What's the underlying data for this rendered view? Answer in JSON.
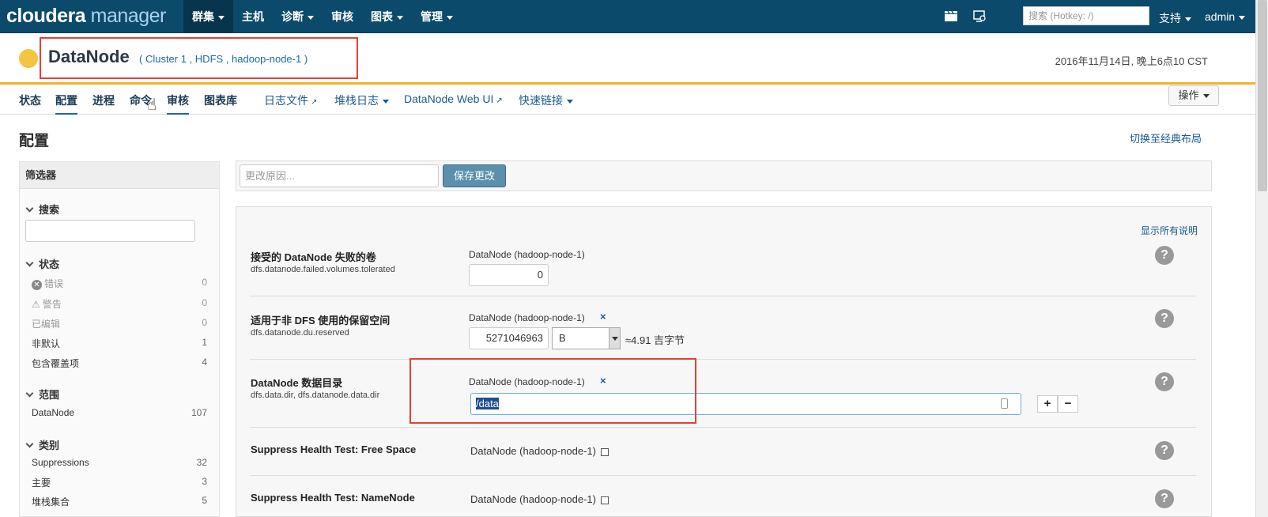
{
  "topnav": {
    "brand_a": "cloudera",
    "brand_b": "manager",
    "items": [
      "群集",
      "主机",
      "诊断",
      "审核",
      "图表",
      "管理"
    ],
    "search_placeholder": "搜索 (Hotkey: /)",
    "support": "支持",
    "user": "admin"
  },
  "header": {
    "title": "DataNode",
    "breadcrumb": "( Cluster 1 , HDFS , hadoop-node-1 )",
    "datetime": "2016年11月14日, 晚上6点10 CST",
    "status_color": "#f4c542"
  },
  "subnav": {
    "tabs": [
      "状态",
      "配置",
      "进程",
      "命令",
      "审核",
      "图表库"
    ],
    "links": [
      "日志文件",
      "堆栈日志",
      "DataNode Web UI",
      "快速链接"
    ],
    "actions": "操作"
  },
  "page": {
    "heading": "配置",
    "classic_layout": "切换至经典布局"
  },
  "filters": {
    "title": "筛选器",
    "search_label": "搜索",
    "status_label": "状态",
    "status_items": [
      {
        "label": "错误",
        "count": "0"
      },
      {
        "label": "警告",
        "count": "0"
      },
      {
        "label": "已编辑",
        "count": "0"
      },
      {
        "label": "非默认",
        "count": "1"
      },
      {
        "label": "包含覆盖项",
        "count": "4"
      }
    ],
    "scope_label": "范围",
    "scope_items": [
      {
        "label": "DataNode",
        "count": "107"
      }
    ],
    "category_label": "类别",
    "category_items": [
      {
        "label": "Suppressions",
        "count": "32"
      },
      {
        "label": "主要",
        "count": "3"
      },
      {
        "label": "堆栈集合",
        "count": "5"
      }
    ]
  },
  "reason": {
    "placeholder": "更改原因...",
    "save": "保存更改"
  },
  "config": {
    "show_all": "显示所有说明",
    "rows": [
      {
        "title": "接受的 DataNode 失败的卷",
        "key": "dfs.datanode.failed.volumes.tolerated",
        "scope": "DataNode (hadoop-node-1)",
        "value": "0"
      },
      {
        "title": "适用于非 DFS 使用的保留空间",
        "key": "dfs.datanode.du.reserved",
        "scope": "DataNode (hadoop-node-1)",
        "value": "5271046963",
        "unit": "B",
        "approx": "≈4.91 吉字节"
      },
      {
        "title": "DataNode 数据目录",
        "key": "dfs.data.dir, dfs.datanode.data.dir",
        "scope": "DataNode (hadoop-node-1)",
        "value": "/data"
      },
      {
        "title": "Suppress Health Test: Free Space",
        "scope": "DataNode (hadoop-node-1)"
      },
      {
        "title": "Suppress Health Test: NameNode",
        "scope": "DataNode (hadoop-node-1)"
      }
    ],
    "remove_mark": "×",
    "help_mark": "?",
    "plus": "+",
    "minus": "−"
  }
}
